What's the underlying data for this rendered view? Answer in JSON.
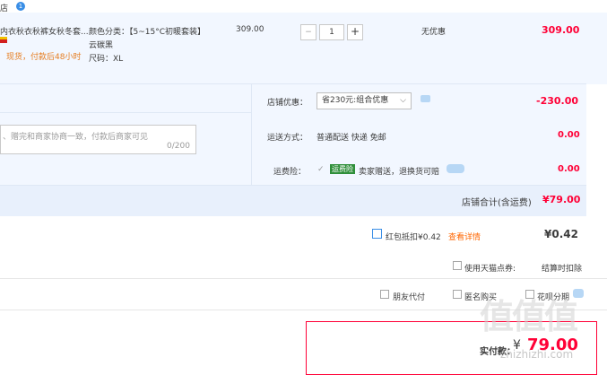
{
  "store": {
    "name_fragment": "店",
    "badge": "1"
  },
  "item": {
    "title": "内衣秋衣秋裤女秋冬套...",
    "stock_note": "现货，付款后48小时",
    "color_label": "颜色分类：【5~15°C初暖套装】",
    "color_value": "云碳黑",
    "size_label": "尺码：XL",
    "unit_price": "309.00",
    "quantity": "1",
    "qty_minus": "−",
    "qty_plus": "+",
    "discount": "无优惠",
    "subtotal": "309.00"
  },
  "message": {
    "placeholder": "、赠完和商家协商一致，付款后商家可见",
    "counter": "0/200"
  },
  "store_discount": {
    "label": "店铺优惠：",
    "selected": "省230元:组合优惠",
    "amount": "-230.00"
  },
  "shipping": {
    "label": "运送方式：",
    "value": "普通配送 快递 免邮",
    "amount": "0.00"
  },
  "freight_insurance": {
    "label": "运费险：",
    "tag": "运费险",
    "value": "卖家赠送，退换货可赔",
    "amount": "0.00"
  },
  "store_total": {
    "label": "店铺合计(含运费)",
    "amount": "¥79.00"
  },
  "red_packet": {
    "label": "红包抵扣¥0.42",
    "link": "查看详情",
    "amount": "¥0.42"
  },
  "tmall_points": {
    "label": "使用天猫点券:",
    "note": "结算时扣除"
  },
  "options": {
    "friend_pay": "朋友代付",
    "anonymous": "匿名购买",
    "huabei": "花呗分期"
  },
  "pay": {
    "label": "实付款：",
    "currency": "¥",
    "amount": "79.00"
  },
  "watermark": {
    "text": "值值值",
    "url": "zhizhizhi.com"
  },
  "colors": {
    "accent": "#ff0036",
    "band": "#f2f7ff",
    "link": "#ff6600"
  }
}
